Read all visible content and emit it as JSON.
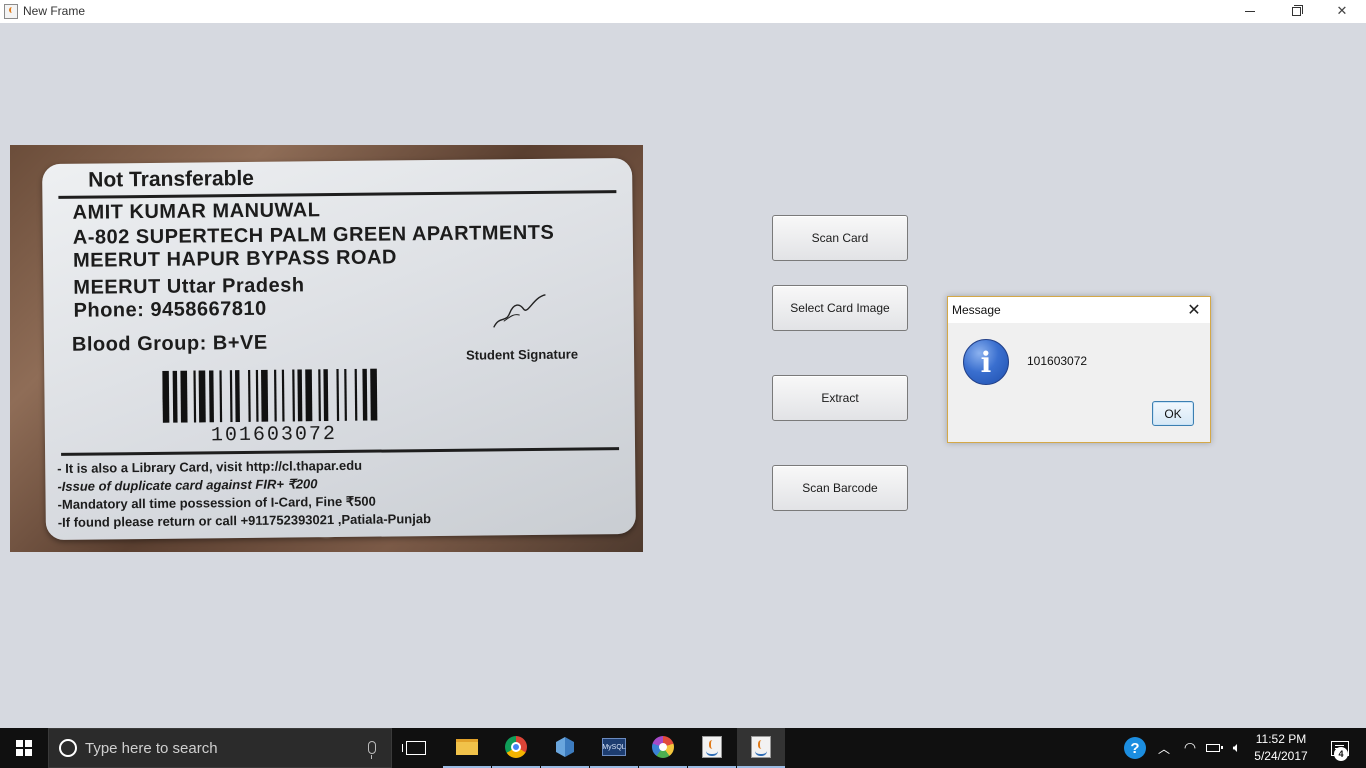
{
  "window": {
    "title": "New Frame",
    "controls": {
      "minimize": "minimize-icon",
      "maximize": "restore-icon",
      "close": "close-icon"
    }
  },
  "card_image": {
    "header": "Not Transferable",
    "name": "AMIT KUMAR MANUWAL",
    "address_line1": "A-802 SUPERTECH PALM GREEN APARTMENTS",
    "address_line2": "MEERUT HAPUR BYPASS ROAD",
    "address_line3": "MEERUT  Uttar Pradesh",
    "phone": "Phone:  9458667810",
    "blood_group": "Blood Group:  B+VE",
    "signature_label": "Student Signature",
    "barcode_number": "101603072",
    "notes": [
      "- It is also a Library Card, visit http://cl.thapar.edu",
      "-Issue of duplicate card against FIR+ ₹200",
      "-Mandatory all time possession of I-Card, Fine  ₹500",
      "-If found please return or call +911752393021 ,Patiala-Punjab"
    ]
  },
  "buttons": {
    "scan_card": "Scan Card",
    "select_card_image": "Select Card Image",
    "extract": "Extract",
    "scan_barcode": "Scan Barcode"
  },
  "dialog": {
    "title": "Message",
    "message": "101603072",
    "ok": "OK",
    "icon": "info-icon"
  },
  "taskbar": {
    "search_placeholder": "Type here to search",
    "mysql_label": "MySQL",
    "time": "11:52 PM",
    "date": "5/24/2017",
    "notification_count": "4",
    "colors": {
      "background": "#101010",
      "search_bg": "#2b2b2b",
      "accent": "#1c8ee0"
    }
  },
  "colors": {
    "window_bg": "#d6d9e0",
    "dialog_border": "#d4a848"
  }
}
